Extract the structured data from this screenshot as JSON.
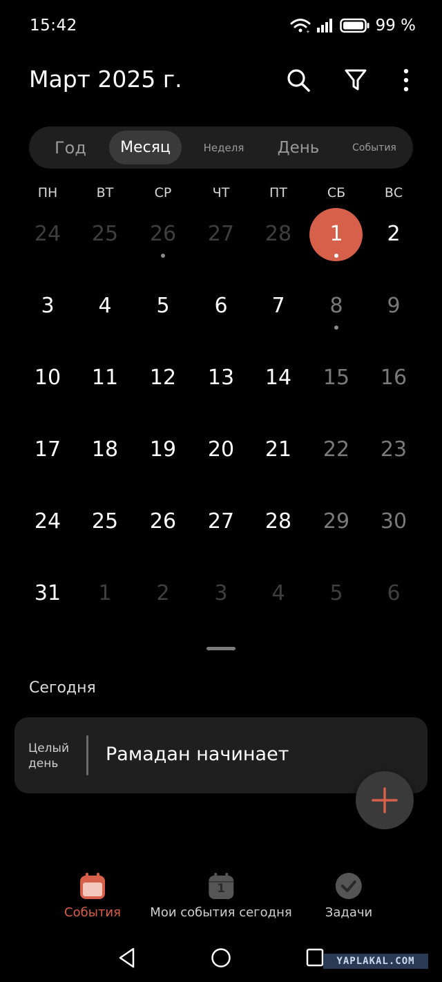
{
  "status_bar": {
    "time": "15:42",
    "battery": "99 %"
  },
  "header": {
    "title": "Март 2025 г."
  },
  "icons": {
    "search": "search-icon",
    "filter": "filter-icon",
    "more": "more-vert-icon"
  },
  "view_tabs": [
    {
      "label": "Год",
      "active": false
    },
    {
      "label": "Месяц",
      "active": true
    },
    {
      "label": "Неделя",
      "active": false
    },
    {
      "label": "День",
      "active": false
    },
    {
      "label": "События",
      "active": false
    }
  ],
  "weekdays": [
    "ПН",
    "ВТ",
    "СР",
    "ЧТ",
    "ПТ",
    "СБ",
    "ВС"
  ],
  "weeks": [
    [
      "24",
      "25",
      "26",
      "27",
      "28",
      "1",
      "2"
    ],
    [
      "3",
      "4",
      "5",
      "6",
      "7",
      "8",
      "9"
    ],
    [
      "10",
      "11",
      "12",
      "13",
      "14",
      "15",
      "16"
    ],
    [
      "17",
      "18",
      "19",
      "20",
      "21",
      "22",
      "23"
    ],
    [
      "24",
      "25",
      "26",
      "27",
      "28",
      "29",
      "30"
    ],
    [
      "31",
      "1",
      "2",
      "3",
      "4",
      "5",
      "6"
    ]
  ],
  "today": "1",
  "section": {
    "label": "Сегодня"
  },
  "event": {
    "allday": "Целый день",
    "title": "Рамадан начинает"
  },
  "bottom_nav": [
    {
      "label": "События",
      "active": true,
      "icon": "calendar-icon"
    },
    {
      "label": "Мои события сегодня",
      "active": false,
      "icon": "calendar-today-icon",
      "icon_text": "1"
    },
    {
      "label": "Задачи",
      "active": false,
      "icon": "check-circle-icon"
    }
  ],
  "watermark": "YAPLAKAL.COM",
  "colors": {
    "accent": "#d6604a",
    "background": "#000000",
    "card": "#1f1f1f"
  }
}
